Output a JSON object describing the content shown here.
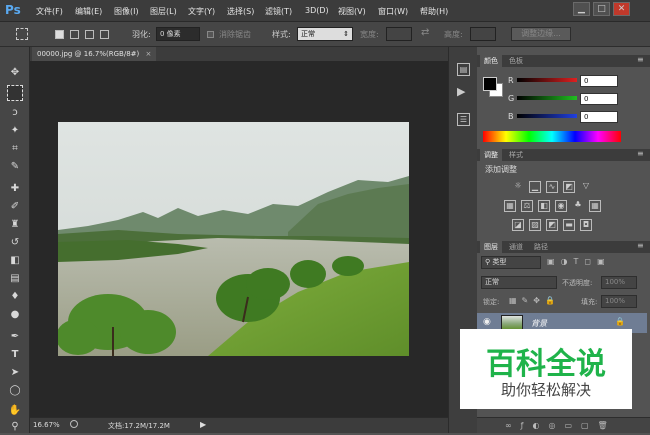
{
  "app": {
    "logo": "Ps"
  },
  "menu": [
    "文件(F)",
    "编辑(E)",
    "图像(I)",
    "图层(L)",
    "文字(Y)",
    "选择(S)",
    "滤镜(T)",
    "3D(D)",
    "视图(V)",
    "窗口(W)",
    "帮助(H)"
  ],
  "window_buttons": [
    "▁",
    "□",
    "✕"
  ],
  "options": {
    "feather_label": "羽化:",
    "feather_value": "0 像素",
    "antialias_label": "消除锯齿",
    "style_label": "样式:",
    "style_value": "正常",
    "width_label": "宽度:",
    "height_label": "高度:",
    "refine_edge_button": "调整边缘..."
  },
  "document": {
    "tab_title": "00000.jpg @ 16.7%(RGB/8#)",
    "tab_close": "×"
  },
  "status": {
    "zoom": "16.67%",
    "doc_info": "文档:17.2M/17.2M"
  },
  "color_panel": {
    "tabs": [
      "颜色",
      "色板"
    ],
    "channels": [
      {
        "label": "R",
        "value": "0",
        "color": "#e02020"
      },
      {
        "label": "G",
        "value": "0",
        "color": "#20c020"
      },
      {
        "label": "B",
        "value": "0",
        "color": "#2040e0"
      }
    ]
  },
  "adjust_panel": {
    "tabs": [
      "调整",
      "样式"
    ],
    "title": "添加调整"
  },
  "layers_panel": {
    "tabs": [
      "图层",
      "通道",
      "路径"
    ],
    "filter_label": "类型",
    "blend_mode": "正常",
    "opacity_label": "不透明度:",
    "opacity_value": "100%",
    "lock_label": "锁定:",
    "fill_label": "填充:",
    "fill_value": "100%",
    "layer_name": "背景"
  },
  "watermark": {
    "title": "百科全说",
    "subtitle": "助你轻松解决"
  },
  "colors": {
    "accent": "#5aa9f0",
    "watermark_green": "#1fb34a"
  }
}
